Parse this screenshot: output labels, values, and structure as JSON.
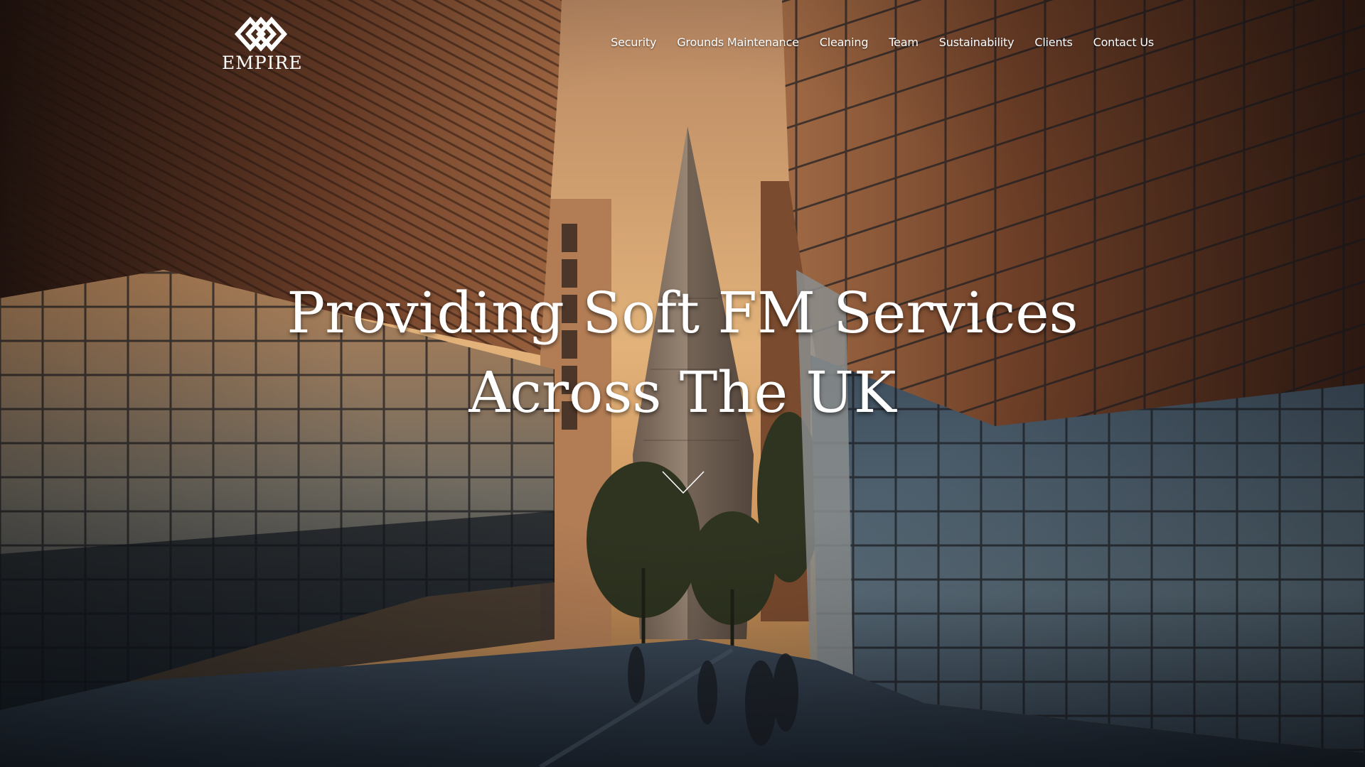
{
  "brand": {
    "name": "EMPIRE",
    "logo_icon": "interlocking-diamonds-logo"
  },
  "nav": {
    "items": [
      {
        "label": "Security"
      },
      {
        "label": "Grounds Maintenance"
      },
      {
        "label": "Cleaning"
      },
      {
        "label": "Team"
      },
      {
        "label": "Sustainability"
      },
      {
        "label": "Clients"
      },
      {
        "label": "Contact Us"
      }
    ]
  },
  "hero": {
    "headline_line1": "Providing Soft FM Services",
    "headline_line2": "Across The UK",
    "scroll_icon": "chevron-down-icon",
    "background": "city-skyline-photo"
  },
  "colors": {
    "text": "#ffffff",
    "sky": "#d8a26a",
    "building_warm": "#6b3f2a",
    "ground": "#2c3a4a"
  }
}
